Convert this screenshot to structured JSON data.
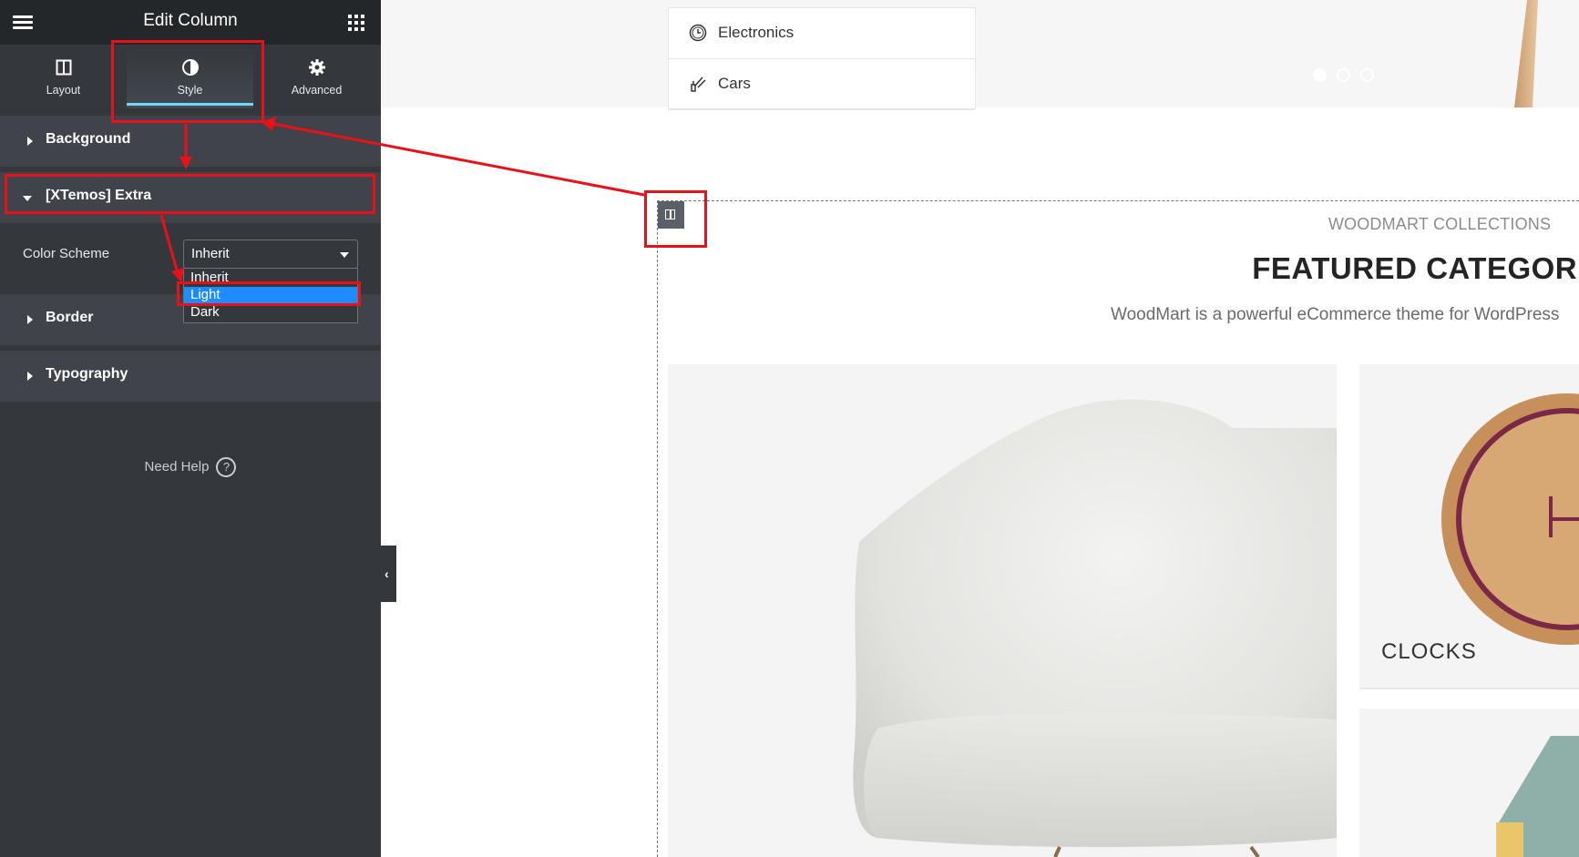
{
  "panel": {
    "title": "Edit Column",
    "tabs": [
      {
        "label": "Layout",
        "icon": "columns-icon"
      },
      {
        "label": "Style",
        "icon": "half-circle-icon",
        "active": true
      },
      {
        "label": "Advanced",
        "icon": "gear-icon"
      }
    ],
    "sections": {
      "background": "Background",
      "extra": "[XTemos] Extra",
      "border": "Border",
      "typography": "Typography"
    },
    "color_scheme": {
      "label": "Color Scheme",
      "value": "Inherit",
      "options": [
        "Inherit",
        "Light",
        "Dark"
      ],
      "highlighted": "Light"
    },
    "need_help": "Need Help",
    "help_glyph": "?"
  },
  "canvas": {
    "categories": [
      {
        "label": "Electronics",
        "icon": "clock-icon"
      },
      {
        "label": "Cars",
        "icon": "tools-icon"
      }
    ],
    "collections_label": "WOODMART COLLECTIONS",
    "featured_title": "FEATURED CATEGORIES",
    "featured_desc": "WoodMart is a powerful eCommerce theme for WordPress",
    "clocks_label": "CLOCKS"
  },
  "colors": {
    "panel_bg": "#34383c",
    "header_bg": "#24272a",
    "section_bg": "#404349",
    "tab_accent": "#71d7f7",
    "selected_option": "#1e8bff",
    "annotation_red": "#e8111a"
  }
}
